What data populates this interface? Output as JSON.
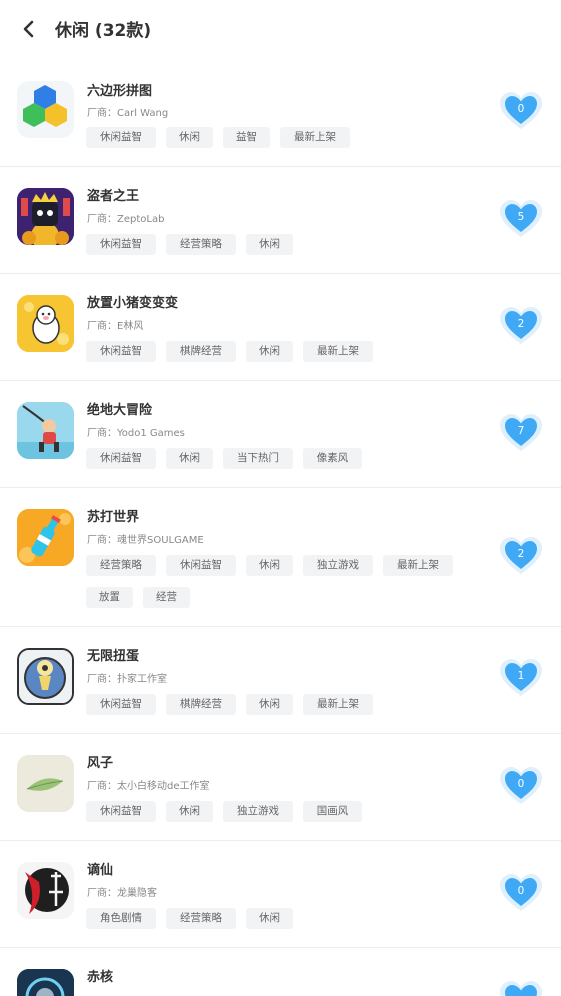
{
  "header": {
    "title": "休闲 (32款)"
  },
  "vendor_prefix": "厂商：",
  "colors": {
    "like_heart": "#3fa9f5",
    "like_halo": "#dff0fc",
    "tag_bg": "#f2f3f5"
  },
  "games": [
    {
      "name": "六边形拼图",
      "vendor": "厂商：Carl Wang",
      "likes": "0",
      "tags": [
        "休闲益智",
        "休闲",
        "益智",
        "最新上架"
      ],
      "icon": "hexagon-puzzle-icon"
    },
    {
      "name": "盗者之王",
      "vendor": "厂商：ZeptoLab",
      "likes": "5",
      "tags": [
        "休闲益智",
        "经营策略",
        "休闲"
      ],
      "icon": "king-of-thieves-icon"
    },
    {
      "name": "放置小猪变变变",
      "vendor": "厂商：E林风",
      "likes": "2",
      "tags": [
        "休闲益智",
        "棋牌经营",
        "休闲",
        "最新上架"
      ],
      "icon": "idle-pig-icon"
    },
    {
      "name": "绝地大冒险",
      "vendor": "厂商：Yodo1 Games",
      "likes": "7",
      "tags": [
        "休闲益智",
        "休闲",
        "当下热门",
        "像素风"
      ],
      "icon": "jump-adventure-icon"
    },
    {
      "name": "苏打世界",
      "vendor": "厂商：魂世界SOULGAME",
      "likes": "2",
      "tags": [
        "经营策略",
        "休闲益智",
        "休闲",
        "独立游戏",
        "最新上架",
        "放置",
        "经营"
      ],
      "icon": "soda-bottle-icon"
    },
    {
      "name": "无限扭蛋",
      "vendor": "厂商：扑家工作室",
      "likes": "1",
      "tags": [
        "休闲益智",
        "棋牌经营",
        "休闲",
        "最新上架"
      ],
      "icon": "gacha-capsule-icon"
    },
    {
      "name": "风子",
      "vendor": "厂商：太小白移动de工作室",
      "likes": "0",
      "tags": [
        "休闲益智",
        "休闲",
        "独立游戏",
        "国画风"
      ],
      "icon": "leaf-icon"
    },
    {
      "name": "谪仙",
      "vendor": "厂商：龙巢隐客",
      "likes": "0",
      "tags": [
        "角色剧情",
        "经营策略",
        "休闲"
      ],
      "icon": "ink-calligraphy-icon"
    },
    {
      "name": "赤核",
      "vendor": "",
      "likes": "",
      "tags": [],
      "icon": "red-core-icon"
    }
  ]
}
